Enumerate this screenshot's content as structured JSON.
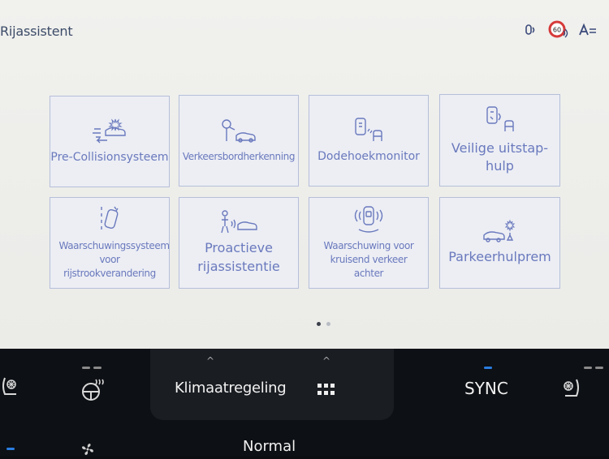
{
  "header": {
    "title": "Rijassistent",
    "status_icons": [
      "voice-icon",
      "speed-limit-icon",
      "language-icon"
    ]
  },
  "tiles": [
    {
      "label": "Pre-Collisionsysteem",
      "icon": "pre-collision-icon"
    },
    {
      "label": "Verkeersbordherkenning",
      "icon": "traffic-sign-icon"
    },
    {
      "label": "Dodehoekmonitor",
      "icon": "blind-spot-icon"
    },
    {
      "label": "Veilige uitstap-hulp",
      "icon": "safe-exit-icon"
    },
    {
      "label": "Waarschuwingssysteem voor rijstrookverandering",
      "icon": "lane-change-icon"
    },
    {
      "label": "Proactieve rijassistentie",
      "icon": "proactive-assist-icon"
    },
    {
      "label": "Waarschuwing voor kruisend verkeer achter",
      "icon": "rear-cross-traffic-icon"
    },
    {
      "label": "Parkeerhulprem",
      "icon": "parking-brake-icon"
    }
  ],
  "pagination": {
    "pages": 2,
    "current": 1
  },
  "climate_bar": {
    "climate_label": "Klimaatregeling",
    "sync_label": "SYNC",
    "mode_label": "Normal",
    "accent_color": "#2a7de1",
    "icons": [
      "seat-heat-left-icon",
      "steering-heat-icon",
      "apps-grid-icon",
      "seat-fan-right-icon",
      "fan-icon"
    ]
  }
}
